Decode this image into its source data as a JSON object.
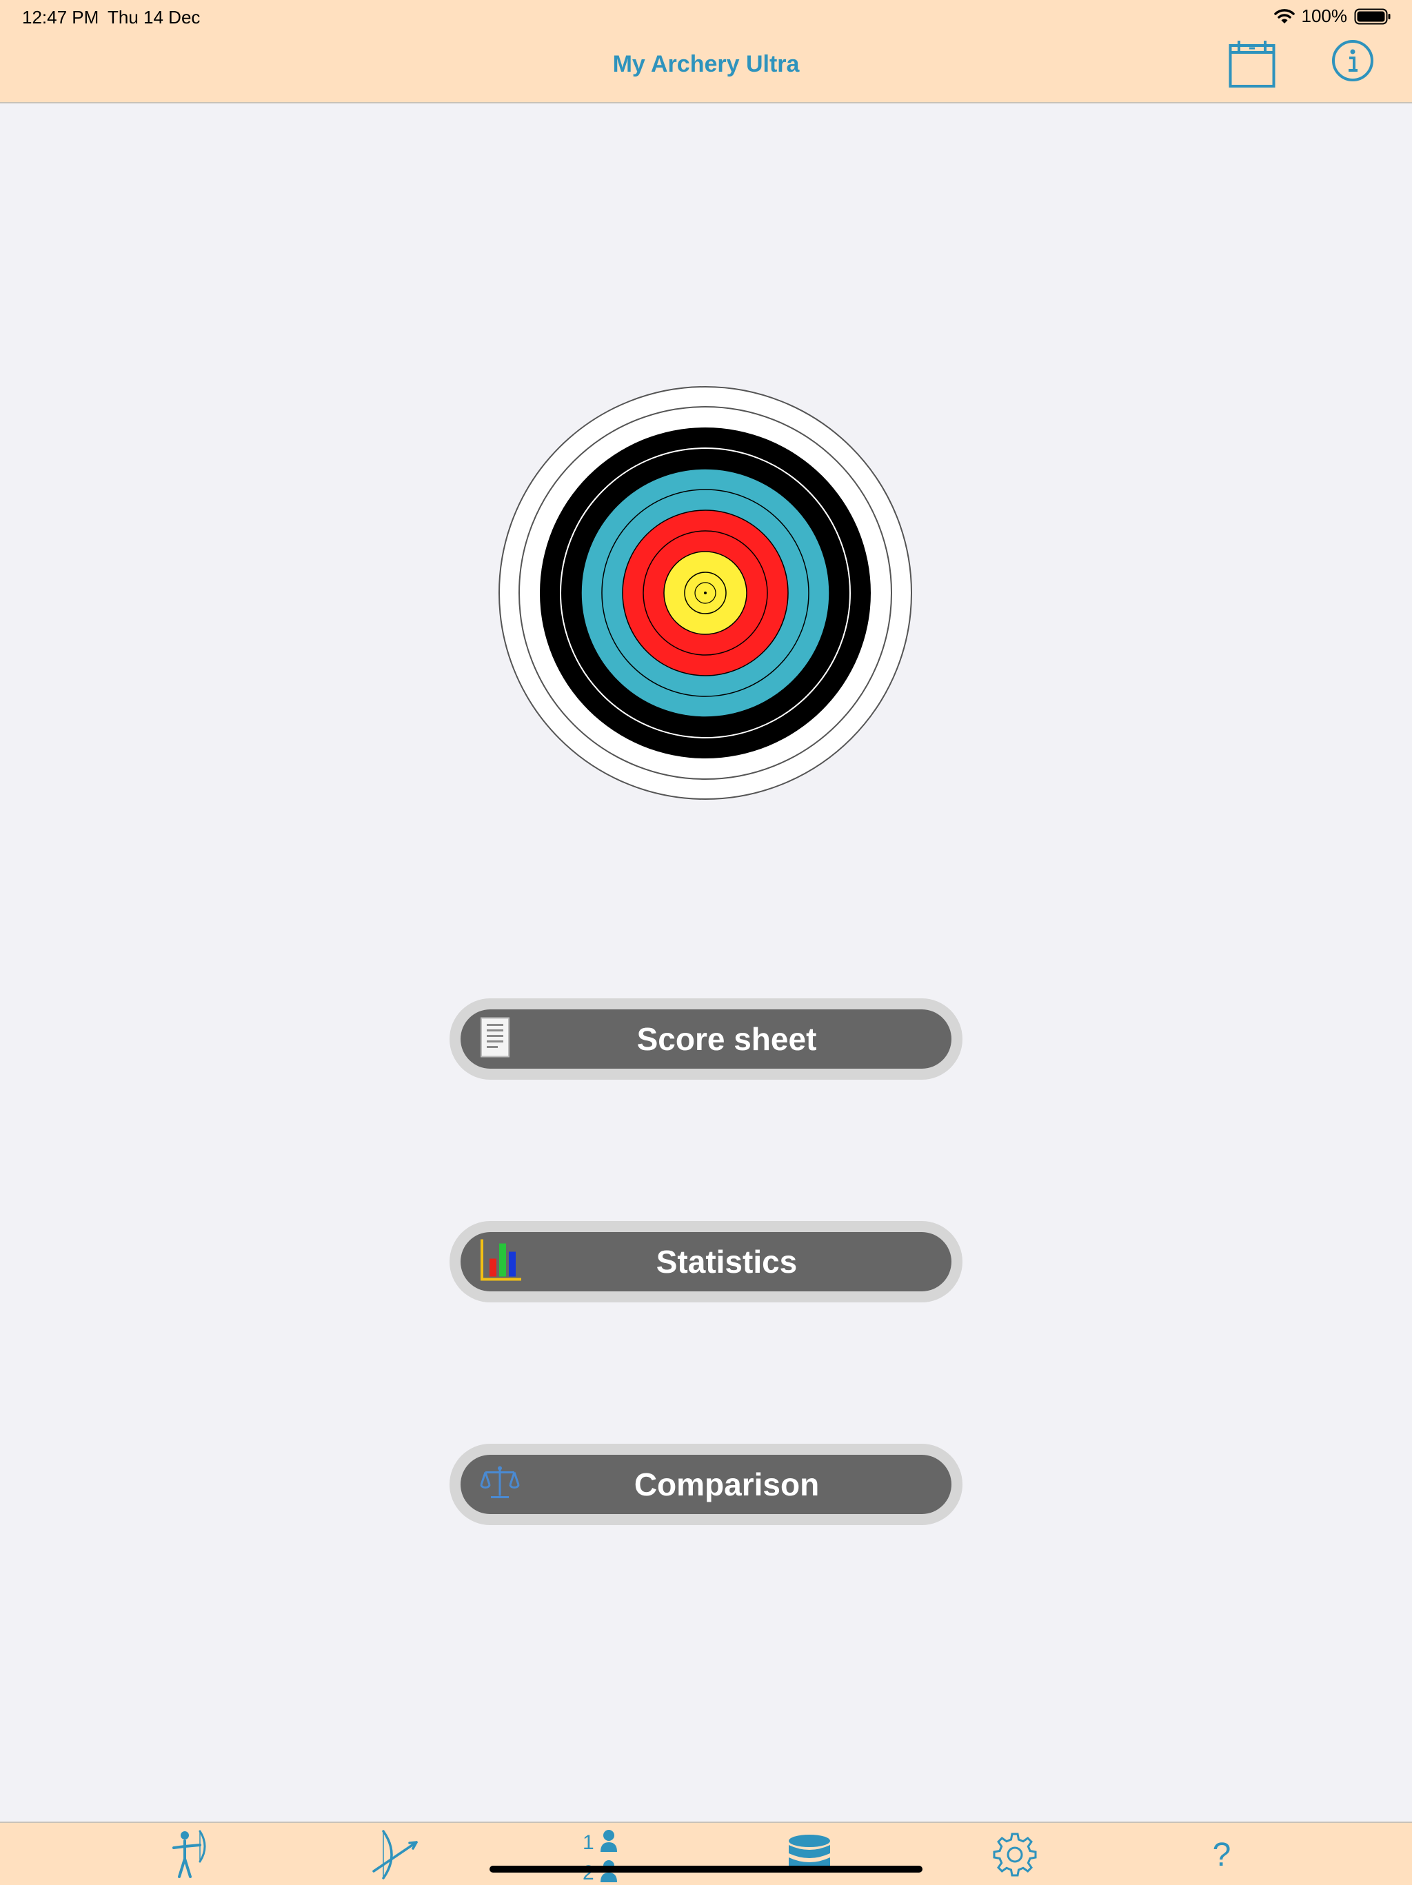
{
  "status_bar": {
    "time": "12:47 PM",
    "date": "Thu 14 Dec",
    "battery": "100%"
  },
  "nav": {
    "title": "My Archery Ultra",
    "calendar_icon": "calendar-icon",
    "info_icon": "info-icon"
  },
  "target": {
    "rings": [
      "white",
      "black",
      "blue",
      "red",
      "yellow"
    ],
    "colors": {
      "white": "#ffffff",
      "black": "#000000",
      "blue": "#3fb3c7",
      "red": "#ff2020",
      "yellow": "#ffef3a"
    }
  },
  "buttons": {
    "score_sheet": {
      "label": "Score sheet",
      "icon": "document-icon"
    },
    "statistics": {
      "label": "Statistics",
      "icon": "bar-chart-icon"
    },
    "comparison": {
      "label": "Comparison",
      "icon": "scales-icon"
    }
  },
  "tabbar": {
    "tabs": [
      {
        "icon": "archer-icon"
      },
      {
        "icon": "bow-icon"
      },
      {
        "icon": "ranking-icon",
        "ranks": [
          "1",
          "2"
        ]
      },
      {
        "icon": "database-icon"
      },
      {
        "icon": "gear-icon"
      },
      {
        "icon": "help-icon",
        "glyph": "?"
      }
    ]
  },
  "colors": {
    "accent": "#2e93bd",
    "bar_background": "#ffe0bf",
    "button_fill": "#666666",
    "button_border": "#d6d6d6"
  }
}
